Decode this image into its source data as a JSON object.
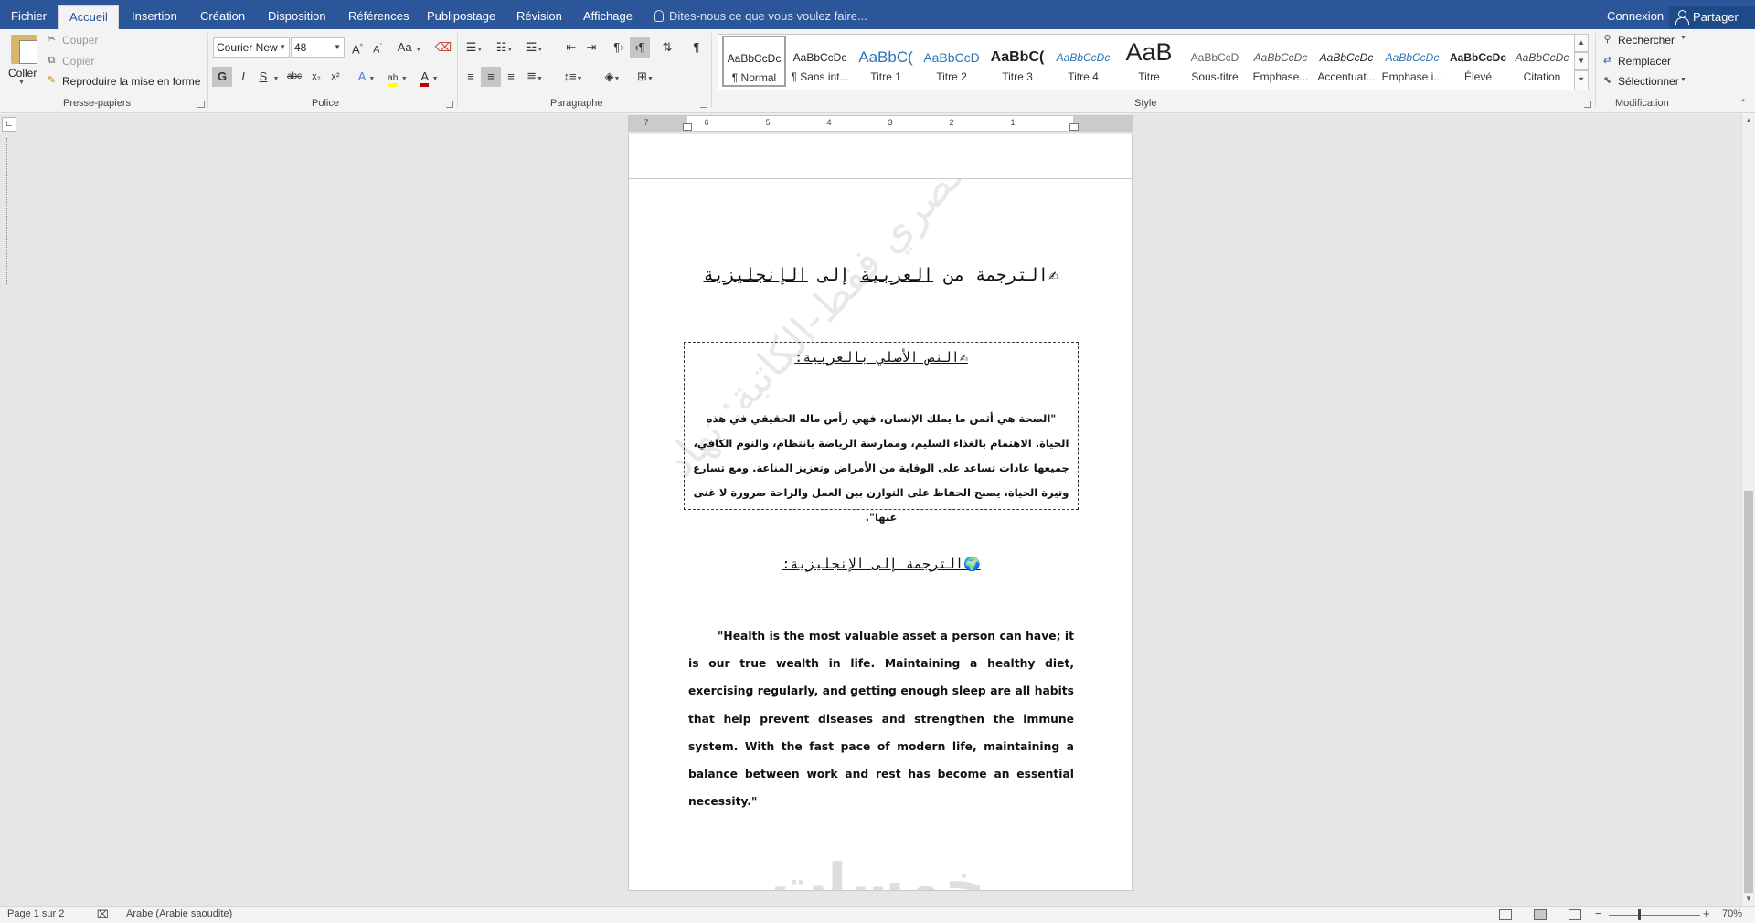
{
  "tabs": [
    "Fichier",
    "Accueil",
    "Insertion",
    "Création",
    "Disposition",
    "Références",
    "Publipostage",
    "Révision",
    "Affichage"
  ],
  "tell_me": "Dites-nous ce que vous voulez faire...",
  "account": {
    "signin": "Connexion",
    "share": "Partager"
  },
  "clipboard": {
    "paste": "Coller",
    "cut": "Couper",
    "copy": "Copier",
    "format_painter": "Reproduire la mise en forme",
    "group": "Presse-papiers"
  },
  "font": {
    "name": "Courier New",
    "size": "48",
    "group": "Police",
    "bold": "G",
    "italic": "I",
    "underline": "S",
    "strike": "abc",
    "sub": "x₂",
    "sup": "x²",
    "grow": "A",
    "shrink": "A",
    "case": "Aa",
    "effects": "A",
    "highlight": "ab",
    "color": "A",
    "highlight_color": "#ffff00",
    "font_color": "#c00000"
  },
  "paragraph": {
    "group": "Paragraphe"
  },
  "styles": {
    "group": "Style",
    "items": [
      {
        "preview": "AaBbCcDc",
        "name": "¶ Normal"
      },
      {
        "preview": "AaBbCcDc",
        "name": "¶ Sans int..."
      },
      {
        "preview": "AaBbC(",
        "name": "Titre 1"
      },
      {
        "preview": "AaBbCcD",
        "name": "Titre 2"
      },
      {
        "preview": "AaBbC(",
        "name": "Titre 3"
      },
      {
        "preview": "AaBbCcDc",
        "name": "Titre 4"
      },
      {
        "preview": "AaB",
        "name": "Titre"
      },
      {
        "preview": "AaBbCcD",
        "name": "Sous-titre"
      },
      {
        "preview": "AaBbCcDc",
        "name": "Emphase..."
      },
      {
        "preview": "AaBbCcDc",
        "name": "Accentuat..."
      },
      {
        "preview": "AaBbCcDc",
        "name": "Emphase i..."
      },
      {
        "preview": "AaBbCcDc",
        "name": "Élevé"
      },
      {
        "preview": "AaBbCcDc",
        "name": "Citation"
      }
    ]
  },
  "editing": {
    "group": "Modification",
    "find": "Rechercher",
    "replace": "Remplacer",
    "select": "Sélectionner"
  },
  "ruler": {
    "numbers": [
      "7",
      "6",
      "5",
      "4",
      "3",
      "2",
      "1"
    ]
  },
  "document": {
    "title_icon": "✍",
    "title_words": [
      "الترجمة",
      "من",
      "العربية",
      "إلى",
      "الإنجليزية"
    ],
    "box_heading": "✍النص الأصلي بالعربية:",
    "arabic_text": "\"الصحة هي أثمن ما يملك الإنسان، فهي رأس ماله الحقيقي في هذه الحياة. الاهتمام بالغذاء السليم، وممارسة الرياضة بانتظام، والنوم الكافي، جميعها عادات تساعد على الوقاية من الأمراض وتعزيز المناعة. ومع تسارع وتيرة الحياة، يصبح الحفاظ على التوازن بين العمل والراحة ضرورة لا غنى عنها\".",
    "translation_heading": "🌍الترجمة إلى الإنجليزية:",
    "english_text": "\"Health is the most valuable asset a person can have; it is our true wealth in life. Maintaining a healthy diet, exercising regularly, and getting enough sleep are all habits that help prevent diseases and strengthen the immune system. With the fast pace of modern life, maintaining a balance between work and rest has become an essential necessity.\"",
    "watermark_diag": "نموذج حصري فقط-الكاتبة: نهاد",
    "watermark_bottom": "خمسات"
  },
  "status": {
    "page": "Page 1 sur 2",
    "language": "Arabe (Arabie saoudite)",
    "zoom": "70%",
    "zoom_level": 0.7
  }
}
